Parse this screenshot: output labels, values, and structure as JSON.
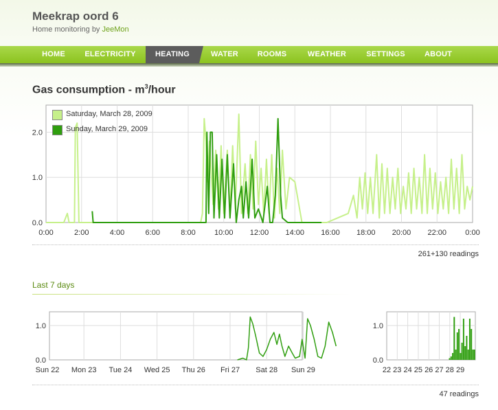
{
  "site": {
    "title": "Meekrap oord 6",
    "subtitle_prefix": "Home monitoring by ",
    "subtitle_link": "JeeMon"
  },
  "nav": [
    {
      "label": "HOME",
      "active": false
    },
    {
      "label": "ELECTRICITY",
      "active": false
    },
    {
      "label": "HEATING",
      "active": true
    },
    {
      "label": "WATER",
      "active": false
    },
    {
      "label": "ROOMS",
      "active": false
    },
    {
      "label": "WEATHER",
      "active": false
    },
    {
      "label": "SETTINGS",
      "active": false
    },
    {
      "label": "ABOUT",
      "active": false
    }
  ],
  "main": {
    "title": "Gas consumption - m",
    "title_sup": "3",
    "title_suffix": "/hour",
    "readings": "261+130 readings"
  },
  "week": {
    "heading": "Last 7 days",
    "readings": "47 readings"
  },
  "colors": {
    "light_series": "#c6f08a",
    "dark_series": "#2f9e0f",
    "grid": "#dddddd",
    "nav_bg": "#96cc2b",
    "nav_active": "#5c5c5c"
  },
  "chart_data": [
    {
      "type": "line",
      "xlabel": "",
      "ylabel": "",
      "xticks": [
        "0:00",
        "2:00",
        "4:00",
        "6:00",
        "8:00",
        "10:00",
        "12:00",
        "14:00",
        "16:00",
        "18:00",
        "20:00",
        "22:00",
        "0:00"
      ],
      "yticks": [
        "0.0",
        "1.0",
        "2.0"
      ],
      "xlim": [
        0,
        24
      ],
      "ylim": [
        0,
        2.6
      ],
      "legend_position": "top-left",
      "series": [
        {
          "name": "Saturday, March 28, 2009",
          "color": "#c6f08a",
          "points": [
            [
              0,
              0
            ],
            [
              1,
              0
            ],
            [
              1.2,
              0.2
            ],
            [
              1.3,
              0
            ],
            [
              1.6,
              0
            ],
            [
              1.65,
              2.1
            ],
            [
              1.75,
              2.2
            ],
            [
              1.85,
              0
            ],
            [
              2.2,
              0
            ],
            [
              8.7,
              0
            ],
            [
              8.8,
              0.2
            ],
            [
              8.9,
              2.3
            ],
            [
              9.0,
              1.8
            ],
            [
              9.1,
              0.9
            ],
            [
              9.2,
              1.8
            ],
            [
              9.4,
              0.4
            ],
            [
              9.55,
              1.6
            ],
            [
              9.7,
              0.3
            ],
            [
              9.85,
              1.7
            ],
            [
              10.0,
              0.2
            ],
            [
              10.2,
              1.6
            ],
            [
              10.35,
              0.2
            ],
            [
              10.5,
              1.7
            ],
            [
              10.65,
              0.3
            ],
            [
              10.85,
              2.4
            ],
            [
              11.0,
              0.2
            ],
            [
              11.2,
              1.3
            ],
            [
              11.35,
              0.2
            ],
            [
              11.5,
              1.5
            ],
            [
              11.65,
              0.3
            ],
            [
              11.8,
              1.8
            ],
            [
              11.95,
              0.4
            ],
            [
              12.1,
              1.2
            ],
            [
              12.25,
              0.2
            ],
            [
              12.4,
              1.4
            ],
            [
              12.55,
              0.2
            ],
            [
              12.7,
              1.5
            ],
            [
              12.85,
              0.1
            ],
            [
              13.0,
              1.2
            ],
            [
              13.15,
              0.2
            ],
            [
              13.3,
              1.6
            ],
            [
              13.5,
              0.3
            ],
            [
              13.7,
              1.0
            ],
            [
              14.0,
              0.9
            ],
            [
              14.4,
              0
            ],
            [
              15.8,
              0
            ],
            [
              16.4,
              0.1
            ],
            [
              17.0,
              0.2
            ],
            [
              17.3,
              0.6
            ],
            [
              17.5,
              0.1
            ],
            [
              17.65,
              1.0
            ],
            [
              17.8,
              0.3
            ],
            [
              17.95,
              1.1
            ],
            [
              18.1,
              0.2
            ],
            [
              18.25,
              1.0
            ],
            [
              18.4,
              0.2
            ],
            [
              18.6,
              1.5
            ],
            [
              18.75,
              0.1
            ],
            [
              18.9,
              1.3
            ],
            [
              19.05,
              0.2
            ],
            [
              19.2,
              1.2
            ],
            [
              19.35,
              0.2
            ],
            [
              19.5,
              1.0
            ],
            [
              19.65,
              0.3
            ],
            [
              19.8,
              1.2
            ],
            [
              19.95,
              0.2
            ],
            [
              20.1,
              0.8
            ],
            [
              20.25,
              0.3
            ],
            [
              20.4,
              1.1
            ],
            [
              20.55,
              0.2
            ],
            [
              20.7,
              1.2
            ],
            [
              20.85,
              0.3
            ],
            [
              21.0,
              1.0
            ],
            [
              21.15,
              0.2
            ],
            [
              21.3,
              1.5
            ],
            [
              21.45,
              0.2
            ],
            [
              21.6,
              1.2
            ],
            [
              21.75,
              0.3
            ],
            [
              21.9,
              1.1
            ],
            [
              22.05,
              0.2
            ],
            [
              22.2,
              0.9
            ],
            [
              22.35,
              0.3
            ],
            [
              22.5,
              1.0
            ],
            [
              22.65,
              0.2
            ],
            [
              22.8,
              1.4
            ],
            [
              22.95,
              0.3
            ],
            [
              23.1,
              1.2
            ],
            [
              23.25,
              0.2
            ],
            [
              23.4,
              1.5
            ],
            [
              23.55,
              0.3
            ],
            [
              23.7,
              0.8
            ],
            [
              23.85,
              0.5
            ],
            [
              24,
              0.8
            ]
          ]
        },
        {
          "name": "Sunday, March 29, 2009",
          "color": "#2f9e0f",
          "points": [
            [
              2.6,
              0.25
            ],
            [
              2.65,
              0
            ],
            [
              9.0,
              0
            ],
            [
              9.05,
              2.0
            ],
            [
              9.15,
              0.2
            ],
            [
              9.25,
              2.0
            ],
            [
              9.35,
              2.0
            ],
            [
              9.45,
              0.1
            ],
            [
              9.6,
              1.5
            ],
            [
              9.75,
              0.1
            ],
            [
              9.9,
              1.4
            ],
            [
              10.05,
              0.1
            ],
            [
              10.2,
              1.5
            ],
            [
              10.35,
              0.1
            ],
            [
              10.55,
              1.3
            ],
            [
              10.7,
              0
            ],
            [
              10.85,
              0.5
            ],
            [
              11.0,
              0.8
            ],
            [
              11.1,
              0.1
            ],
            [
              11.25,
              0.9
            ],
            [
              11.4,
              0.1
            ],
            [
              11.6,
              1.4
            ],
            [
              11.75,
              0.1
            ],
            [
              11.95,
              0.3
            ],
            [
              12.2,
              0
            ],
            [
              12.45,
              0.8
            ],
            [
              12.6,
              0
            ],
            [
              12.75,
              0
            ],
            [
              12.9,
              0.6
            ],
            [
              13.05,
              2.3
            ],
            [
              13.2,
              0.6
            ],
            [
              13.3,
              0.1
            ],
            [
              13.6,
              0
            ],
            [
              14.5,
              0
            ],
            [
              15.5,
              0
            ]
          ]
        }
      ]
    },
    {
      "type": "line",
      "xticks": [
        "Sun 22",
        "Mon 23",
        "Tue 24",
        "Wed 25",
        "Thu 26",
        "Fri 27",
        "Sat 28",
        "Sun 29"
      ],
      "yticks": [
        "0.0",
        "1.0"
      ],
      "xlim": [
        0,
        7.1
      ],
      "ylim": [
        0,
        1.4
      ],
      "series": [
        {
          "color": "#2f9e0f",
          "points": [
            [
              5.2,
              0
            ],
            [
              5.35,
              0.05
            ],
            [
              5.45,
              0
            ],
            [
              5.5,
              0.35
            ],
            [
              5.55,
              1.25
            ],
            [
              5.62,
              1.05
            ],
            [
              5.7,
              0.7
            ],
            [
              5.8,
              0.2
            ],
            [
              5.9,
              0.1
            ],
            [
              6.0,
              0.3
            ],
            [
              6.1,
              0.6
            ],
            [
              6.2,
              0.8
            ],
            [
              6.28,
              0.45
            ],
            [
              6.35,
              0.75
            ],
            [
              6.42,
              0.4
            ],
            [
              6.5,
              0.1
            ],
            [
              6.6,
              0.4
            ],
            [
              6.7,
              0.2
            ],
            [
              6.78,
              0.05
            ],
            [
              6.9,
              0.1
            ],
            [
              6.97,
              0.6
            ],
            [
              7.05,
              0.05
            ],
            [
              7.12,
              1.2
            ],
            [
              7.2,
              1.0
            ],
            [
              7.3,
              0.6
            ],
            [
              7.4,
              0.1
            ],
            [
              7.5,
              0.05
            ],
            [
              7.6,
              0.4
            ],
            [
              7.7,
              1.1
            ],
            [
              7.8,
              0.8
            ],
            [
              7.9,
              0.4
            ]
          ]
        }
      ]
    },
    {
      "type": "bar",
      "xticks": [
        "22",
        "23",
        "24",
        "25",
        "26",
        "27",
        "28",
        "29"
      ],
      "yticks": [
        "0.0",
        "1.0"
      ],
      "ylim": [
        0,
        1.4
      ],
      "series": [
        {
          "color": "#2f9e0f",
          "values": [
            0,
            0,
            0,
            0,
            0,
            0,
            0,
            0,
            0,
            0,
            0,
            0,
            0,
            0,
            0,
            0,
            0,
            0,
            0,
            0,
            0,
            0,
            0,
            0,
            0,
            0,
            0,
            0,
            0,
            0,
            0,
            0,
            0,
            0,
            0,
            0,
            0,
            0,
            0,
            0,
            0.05,
            0.1,
            0.2,
            1.25,
            0.3,
            0.8,
            0.9,
            0.2,
            0.5,
            1.2,
            0.4,
            0.7,
            0.3,
            1.2,
            0.9,
            0.3,
            0.3
          ]
        }
      ]
    }
  ]
}
